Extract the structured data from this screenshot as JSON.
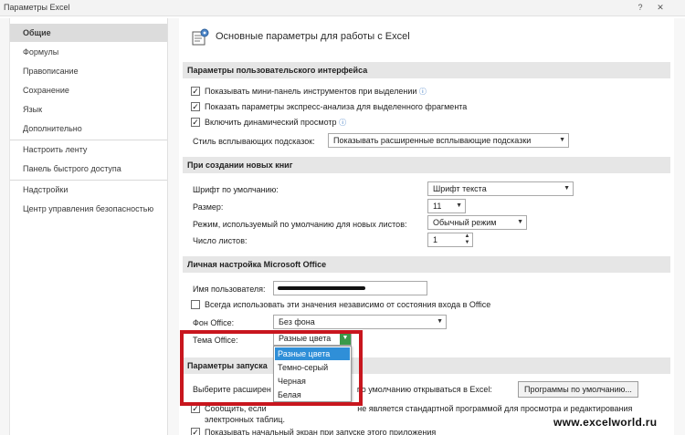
{
  "window": {
    "title": "Параметры Excel",
    "help_glyph": "?",
    "close_glyph": "✕"
  },
  "nav": {
    "items": [
      {
        "label": "Общие",
        "active": true
      },
      {
        "label": "Формулы"
      },
      {
        "label": "Правописание"
      },
      {
        "label": "Сохранение"
      },
      {
        "label": "Язык"
      },
      {
        "label": "Дополнительно"
      },
      {
        "label": "Настроить ленту"
      },
      {
        "label": "Панель быстрого доступа"
      },
      {
        "label": "Надстройки"
      },
      {
        "label": "Центр управления безопасностью"
      }
    ]
  },
  "header": {
    "title": "Основные параметры для работы с Excel",
    "icon": "general-options-icon"
  },
  "ui_section": {
    "title": "Параметры пользовательского интерфейса",
    "checkboxes": [
      {
        "label": "Показывать мини-панель инструментов при выделении",
        "checked": true,
        "info": "ⓘ"
      },
      {
        "label": "Показать параметры экспресс-анализа для выделенного фрагмента",
        "checked": true
      },
      {
        "label": "Включить динамический просмотр",
        "checked": true,
        "info": "ⓘ"
      }
    ],
    "tooltip_style_label": "Стиль всплывающих подсказок:",
    "tooltip_style_value": "Показывать расширенные всплывающие подсказки"
  },
  "new_books": {
    "title": "При создании новых книг",
    "font_label": "Шрифт по умолчанию:",
    "font_value": "Шрифт текста",
    "size_label": "Размер:",
    "size_value": "11",
    "view_label": "Режим, используемый по умолчанию для новых листов:",
    "view_value": "Обычный режим",
    "sheets_label": "Число листов:",
    "sheets_value": "1"
  },
  "personal": {
    "title": "Личная настройка Microsoft Office",
    "username_label": "Имя пользователя:",
    "always_label": "Всегда использовать эти значения независимо от состояния входа в Office",
    "always_checked": false,
    "background_label": "Фон Office:",
    "background_value": "Без фона",
    "theme_label": "Тема Office:",
    "theme_value": "Разные цвета",
    "theme_options": [
      "Разные цвета",
      "Темно-серый",
      "Черная",
      "Белая"
    ],
    "theme_highlighted_index": 0
  },
  "startup": {
    "title": "Параметры запуска",
    "ext_label_start": "Выберите расширен",
    "ext_label_end": "по умолчанию открываться в Excel:",
    "default_programs_button": "Программы по умолчанию...",
    "notify_label_start": "Сообщить, если",
    "notify_label_end": "не является стандартной программой для просмотра и редактирования",
    "notify_label_line2": "электронных таблиц.",
    "notify_checked": true,
    "show_start_label": "Показывать начальный экран при запуске этого приложения",
    "show_start_checked": true
  },
  "watermark": "www.excelworld.ru",
  "colors": {
    "highlight": "#2f8fd8",
    "annotation": "#c8161e",
    "section_bg": "#e6e6e6"
  }
}
